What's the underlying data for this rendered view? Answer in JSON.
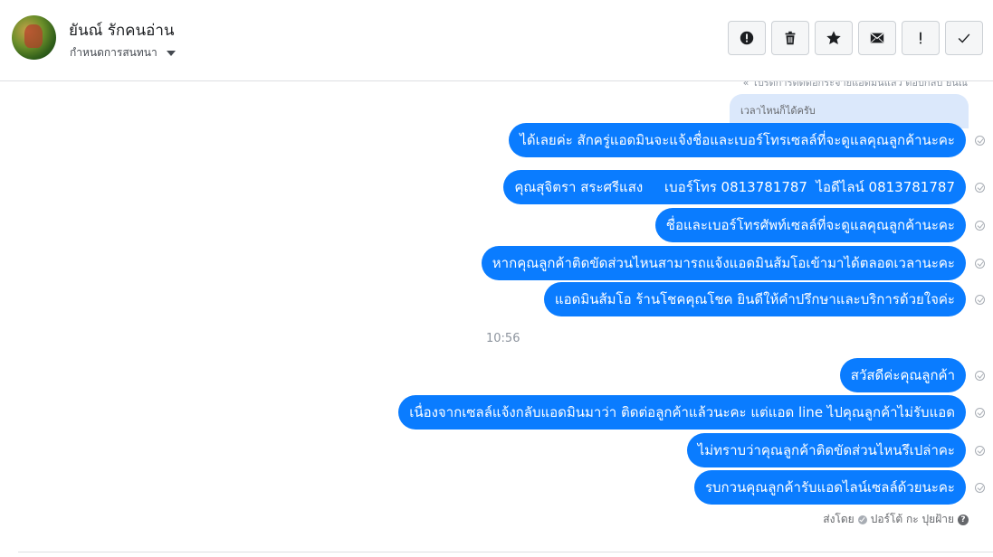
{
  "header": {
    "user_name": "ยันณ์ รักคนอ่าน",
    "assign_label": "กำหนดการสนทนา"
  },
  "toolbar": {
    "buttons": [
      {
        "icon": "alert-circle-icon",
        "label": "spam"
      },
      {
        "icon": "trash-icon",
        "label": "delete"
      },
      {
        "icon": "star-icon",
        "label": "star"
      },
      {
        "icon": "envelope-icon",
        "label": "mark unread"
      },
      {
        "icon": "exclamation-icon",
        "label": "follow up"
      },
      {
        "icon": "checkmark-icon",
        "label": "done"
      }
    ]
  },
  "thread": {
    "clipped_note": "« โปรดการติดต่อกระจายแอดมินแล้ว ตอบกลับ ยันณ",
    "quoted_reply": "เวลาไหนก็ได้ครับ",
    "messages_before": [
      "ได้เลยค่ะ สักครู่แอดมินจะแจ้งชื่อและเบอร์โทรเซลล์ที่จะดูแลคุณลูกค้านะคะ",
      "คุณสุจิตรา สระศรีแสง     เบอร์โทร 0813781787  ไอดีไลน์ 0813781787",
      "ชื่อและเบอร์โทรศัพท์เซลล์ที่จะดูแลคุณลูกค้านะคะ",
      "หากคุณลูกค้าติดขัดส่วนไหนสามารถแจ้งแอดมินส้มโอเข้ามาได้ตลอดเวลานะคะ",
      "แอดมินส้มโอ ร้านโชคคุณโชค ยินดีให้คำปรึกษาและบริการด้วยใจค่ะ"
    ],
    "timestamp": "10:56",
    "messages_after": [
      "สวัสดีค่ะคุณลูกค้า",
      "เนื่องจากเซลล์แจ้งกลับแอดมินมาว่า ติดต่อลูกค้าแล้วนะคะ แต่แอด line ไปคุณลูกค้าไม่รับแอด",
      "ไม่ทราบว่าคุณลูกค้าติดขัดส่วนไหนรึเปล่าคะ",
      "รบกวนคุณลูกค้ารับแอดไลน์เซลล์ด้วยนะคะ"
    ],
    "sent_by_prefix": "ส่งโดย",
    "sent_by_name": "ปอร์โต้ กะ ปุยฝ้าย",
    "help_glyph": "?"
  },
  "colors": {
    "bubble": "#0a7cff",
    "quoted_bg": "#dbe8fb",
    "border": "#dddfe2"
  }
}
